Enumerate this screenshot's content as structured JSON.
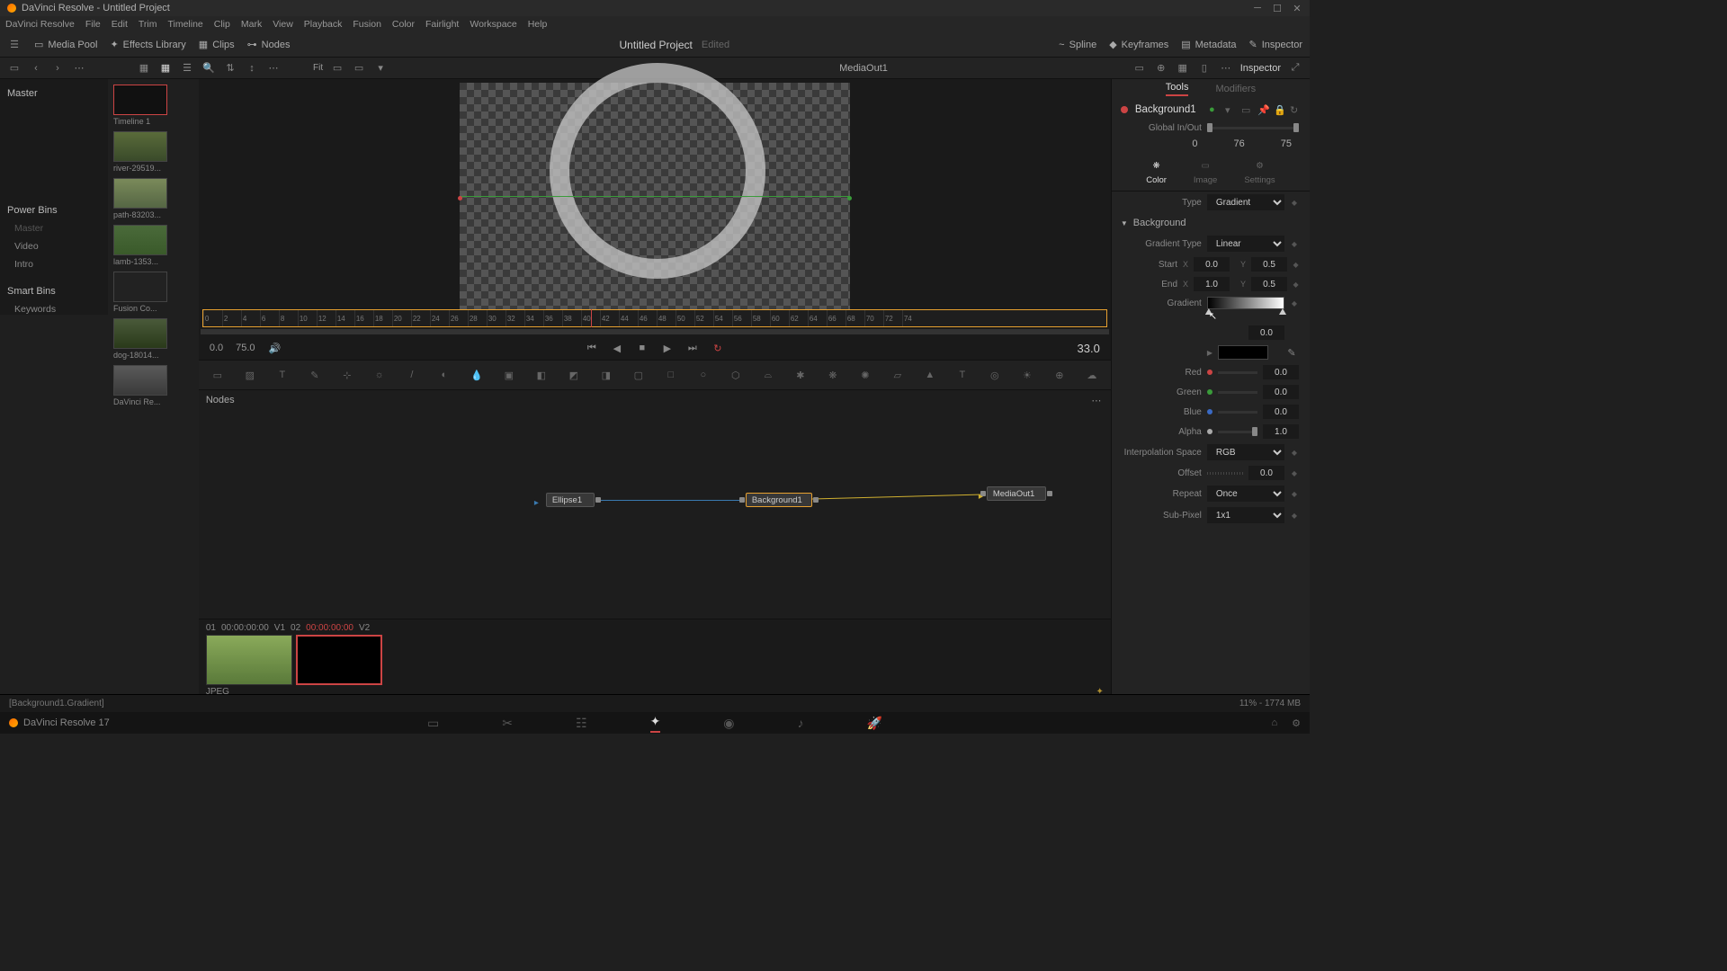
{
  "app": {
    "title": "DaVinci Resolve - Untitled Project",
    "name": "DaVinci Resolve",
    "version": "DaVinci Resolve 17"
  },
  "menu": [
    "File",
    "Edit",
    "Trim",
    "Timeline",
    "Clip",
    "Mark",
    "View",
    "Playback",
    "Fusion",
    "Color",
    "Fairlight",
    "Workspace",
    "Help"
  ],
  "toolbar": {
    "media_pool": "Media Pool",
    "effects_library": "Effects Library",
    "clips": "Clips",
    "nodes": "Nodes",
    "spline": "Spline",
    "keyframes": "Keyframes",
    "metadata": "Metadata",
    "inspector": "Inspector"
  },
  "project": {
    "title": "Untitled Project",
    "status": "Edited"
  },
  "viewer": {
    "title": "MediaOut1",
    "fit": "Fit"
  },
  "inspector_title": "Inspector",
  "bins": {
    "master": "Master",
    "power_bins": "Power Bins",
    "items": [
      "Master",
      "Video",
      "Intro"
    ],
    "smart_bins": "Smart Bins",
    "keywords": "Keywords"
  },
  "clips": [
    {
      "label": "Timeline 1"
    },
    {
      "label": "river-29519..."
    },
    {
      "label": "path-83203..."
    },
    {
      "label": "lamb-1353..."
    },
    {
      "label": "Fusion Co..."
    },
    {
      "label": "dog-18014..."
    },
    {
      "label": "DaVinci Re..."
    }
  ],
  "transport": {
    "start": "0.0",
    "end": "75.0",
    "current": "33.0"
  },
  "nodes": {
    "title": "Nodes",
    "items": [
      {
        "name": "Ellipse1"
      },
      {
        "name": "Background1"
      },
      {
        "name": "MediaOut1"
      }
    ]
  },
  "bottom_clips": {
    "meta1": "01",
    "tc1": "00:00:00:00",
    "v1": "V1",
    "meta2": "02",
    "tc2": "00:00:00:00",
    "v2": "V2",
    "format": "JPEG"
  },
  "inspector": {
    "tabs": {
      "tools": "Tools",
      "modifiers": "Modifiers"
    },
    "node_name": "Background1",
    "global_inout": "Global In/Out",
    "gio_values": {
      "a": "0",
      "b": "76",
      "c": "75"
    },
    "subtabs": {
      "color": "Color",
      "image": "Image",
      "settings": "Settings"
    },
    "type_label": "Type",
    "type_value": "Gradient",
    "section": "Background",
    "gradient_type_label": "Gradient Type",
    "gradient_type_value": "Linear",
    "start_label": "Start",
    "end_label": "End",
    "start_x": "0.0",
    "start_y": "0.5",
    "end_x": "1.0",
    "end_y": "0.5",
    "gradient_label": "Gradient",
    "position_value": "0.0",
    "red_label": "Red",
    "red_value": "0.0",
    "green_label": "Green",
    "green_value": "0.0",
    "blue_label": "Blue",
    "blue_value": "0.0",
    "alpha_label": "Alpha",
    "alpha_value": "1.0",
    "interp_label": "Interpolation Space",
    "interp_value": "RGB",
    "offset_label": "Offset",
    "offset_value": "0.0",
    "repeat_label": "Repeat",
    "repeat_value": "Once",
    "subpixel_label": "Sub-Pixel",
    "subpixel_value": "1x1"
  },
  "status": {
    "hint": "[Background1.Gradient]",
    "gpu": "11% - 1774 MB"
  }
}
